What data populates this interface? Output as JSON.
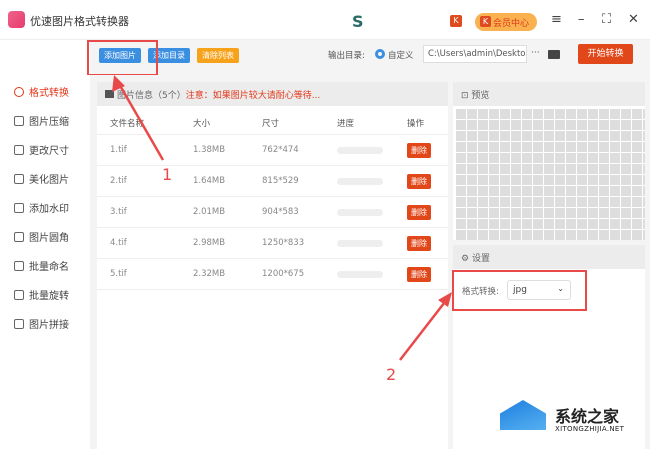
{
  "app": {
    "title": "优速图片格式转换器",
    "vip_label": "会员中心"
  },
  "toolbar": {
    "add_image": "添加图片",
    "add_folder": "添加目录",
    "clear_list": "清除列表",
    "output_label": "输出目录:",
    "output_option": "自定义",
    "output_path": "C:\\Users\\admin\\Deskto",
    "more": "···",
    "start": "开始转换"
  },
  "sidebar": {
    "items": [
      {
        "label": "格式转换"
      },
      {
        "label": "图片压缩"
      },
      {
        "label": "更改尺寸"
      },
      {
        "label": "美化图片"
      },
      {
        "label": "添加水印"
      },
      {
        "label": "图片圆角"
      },
      {
        "label": "批量命名"
      },
      {
        "label": "批量旋转"
      },
      {
        "label": "图片拼接"
      }
    ]
  },
  "list": {
    "header": "图片信息（5个）",
    "notice": "注意：如果图片较大请耐心等待...",
    "columns": [
      "文件名称",
      "大小",
      "尺寸",
      "进度",
      "操作"
    ],
    "rows": [
      {
        "name": "1.tif",
        "size": "1.38MB",
        "dim": "762*474",
        "progress": 0,
        "action": "删除"
      },
      {
        "name": "2.tif",
        "size": "1.64MB",
        "dim": "815*529",
        "progress": 0,
        "action": "删除"
      },
      {
        "name": "3.tif",
        "size": "2.01MB",
        "dim": "904*583",
        "progress": 0,
        "action": "删除"
      },
      {
        "name": "4.tif",
        "size": "2.98MB",
        "dim": "1250*833",
        "progress": 0,
        "action": "删除"
      },
      {
        "name": "5.tif",
        "size": "2.32MB",
        "dim": "1200*675",
        "progress": 0,
        "action": "删除"
      }
    ]
  },
  "preview": {
    "title": "预览"
  },
  "settings": {
    "title": "设置",
    "format_label": "格式转换:",
    "format_value": "jpg"
  },
  "annotations": {
    "step1": "1",
    "step2": "2"
  },
  "watermark": {
    "name": "系统之家",
    "url": "XITONGZHIJIA.NET"
  }
}
